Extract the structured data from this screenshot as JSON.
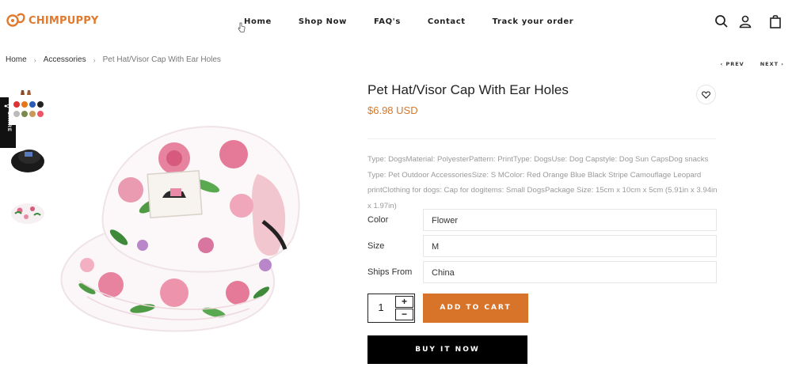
{
  "header": {
    "logo_text": "CHIMPUPPY",
    "nav": {
      "home": "Home",
      "shop": "Shop Now",
      "faq": "FAQ's",
      "contact": "Contact",
      "track": "Track your order"
    },
    "icons": [
      "search-icon",
      "user-icon",
      "shopping-bag-icon"
    ]
  },
  "breadcrumb": {
    "home": "Home",
    "category": "Accessories",
    "current": "Pet Hat/Visor Cap With Ear Holes"
  },
  "pager": {
    "prev": "‹  PREV",
    "next": "NEXT  ›"
  },
  "share": {
    "label": "SHARE"
  },
  "product": {
    "title": "Pet Hat/Visor Cap With Ear Holes",
    "price": "$6.98 USD",
    "description": "Type: DogsMaterial: PolyesterPattern: PrintType: DogsUse: Dog Capstyle: Dog Sun CapsDog snacks Type: Pet Outdoor AccessoriesSize: S MColor: Red Orange Blue Black Stripe Camouflage Leopard printClothing for dogs: Cap for dogitems: Small DogsPackage Size: 15cm x 10cm x 5cm (5.91in x 3.94in x 1.97in)",
    "options": {
      "color_label": "Color",
      "color_value": "Flower",
      "size_label": "Size",
      "size_value": "M",
      "ships_label": "Ships From",
      "ships_value": "China"
    },
    "quantity": "1",
    "qty_plus": "+",
    "qty_minus": "−",
    "add_to_cart": "ADD TO CART",
    "buy_now": "BUY IT NOW"
  },
  "colors": {
    "brand": "#e07a2e",
    "price": "#d4782d",
    "cta": "#d8732a",
    "buy_now": "#000000"
  }
}
